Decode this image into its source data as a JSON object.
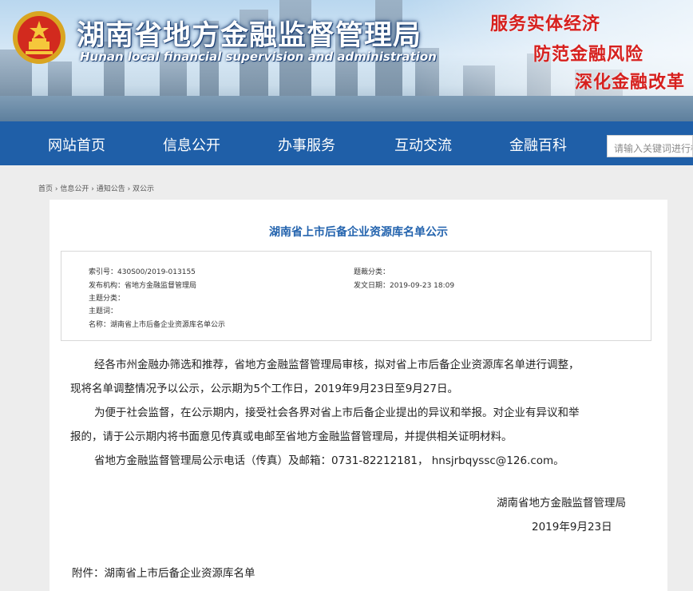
{
  "header": {
    "title": "湖南省地方金融监督管理局",
    "subtitle": "Hunan local financial supervision and administration",
    "slogans": [
      "服务实体经济",
      "防范金融风险",
      "深化金融改革"
    ]
  },
  "nav": {
    "items": [
      "网站首页",
      "信息公开",
      "办事服务",
      "互动交流",
      "金融百科"
    ],
    "search_placeholder": "请输入关键词进行检索"
  },
  "breadcrumb": [
    "首页",
    "信息公开",
    "通知公告",
    "双公示"
  ],
  "breadcrumb_sep": " › ",
  "article": {
    "title": "湖南省上市后备企业资源库名单公示",
    "meta": {
      "index_label": "索引号：",
      "index_value": "430S00/2019-013155",
      "category_label": "题裁分类：",
      "category_value": "",
      "org_label": "发布机构：",
      "org_value": "省地方金融监督管理局",
      "date_label": "发文日期：",
      "date_value": "2019-09-23 18:09",
      "topic_label": "主题分类：",
      "topic_value": "",
      "keywords_label": "主题词：",
      "keywords_value": "",
      "name_label": "名称：",
      "name_value": "湖南省上市后备企业资源库名单公示"
    },
    "paragraphs": [
      "经各市州金融办筛选和推荐，省地方金融监督管理局审核，拟对省上市后备企业资源库名单进行调整，",
      "现将名单调整情况予以公示，公示期为5个工作日，2019年9月23日至9月27日。",
      "为便于社会监督，在公示期内，接受社会各界对省上市后备企业提出的异议和举报。对企业有异议和举",
      "报的，请于公示期内将书面意见传真或电邮至省地方金融监督管理局，并提供相关证明材料。",
      "省地方金融监督管理局公示电话（传真）及邮箱：0731-82212181，  hnsjrbqyssc@126.com。"
    ],
    "sign_org": "湖南省地方金融监督管理局",
    "sign_date": "2019年9月23日",
    "attachment": "附件：湖南省上市后备企业资源库名单"
  },
  "colors": {
    "nav_bg": "#1f5fa8",
    "title_blue": "#2464ae",
    "slogan_red": "#d6201e"
  }
}
